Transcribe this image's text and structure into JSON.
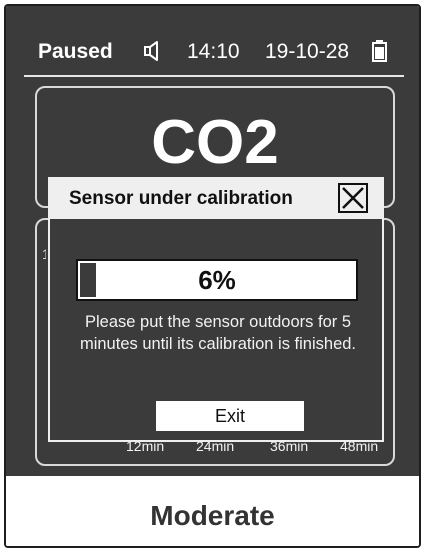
{
  "status_bar": {
    "state": "Paused",
    "time": "14:10",
    "date": "19-10-28",
    "sound_icon": "speaker-icon",
    "battery_icon": "battery-icon",
    "battery_level": 0.75
  },
  "reading": {
    "gas": "CO2"
  },
  "chart": {
    "x_ticks": [
      "12min",
      "24min",
      "36min",
      "48min"
    ],
    "y_fragment": "1"
  },
  "dialog": {
    "title": "Sensor under calibration",
    "close_icon": "close-icon",
    "progress_percent": 6,
    "progress_text": "6%",
    "message": "Please put the sensor outdoors for 5 minutes until its calibration is finished.",
    "exit_label": "Exit"
  },
  "bottom_bar": {
    "level": "Moderate"
  },
  "colors": {
    "screen_bg": "#3b3b3b",
    "text_light": "#ffffff",
    "dialog_header": "#efefef"
  }
}
